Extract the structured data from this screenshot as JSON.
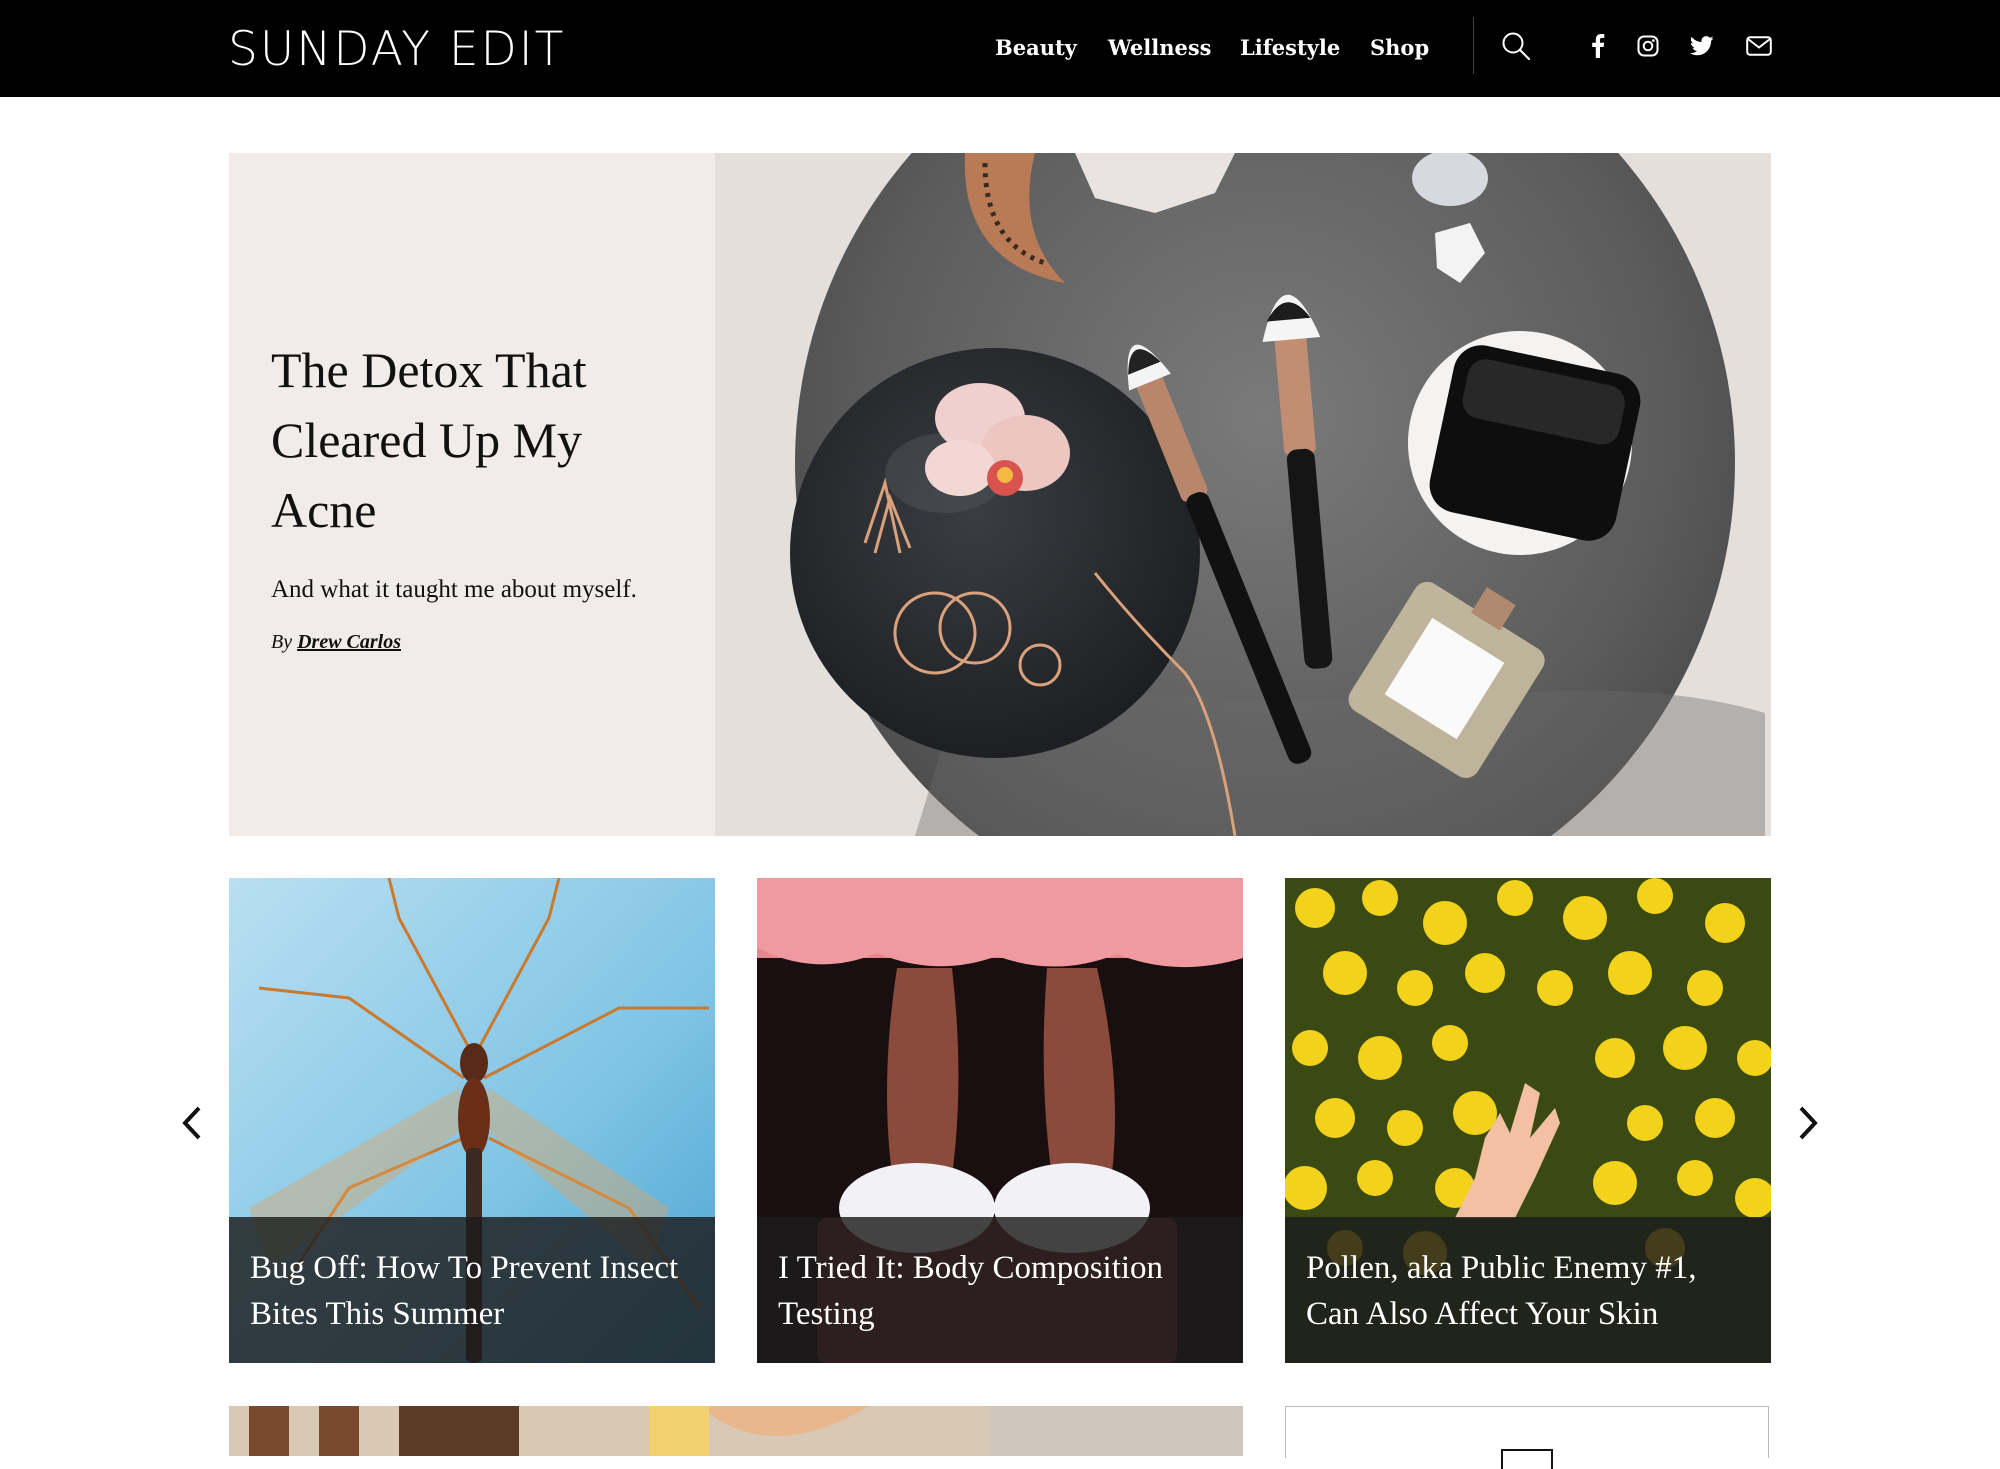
{
  "site": {
    "logo": "SUNDAY EDIT"
  },
  "nav": {
    "items": [
      {
        "label": "Beauty"
      },
      {
        "label": "Wellness"
      },
      {
        "label": "Lifestyle"
      },
      {
        "label": "Shop"
      }
    ]
  },
  "header_icons": [
    "search-icon",
    "facebook-icon",
    "instagram-icon",
    "twitter-icon",
    "email-icon"
  ],
  "hero": {
    "title": "The Detox That Cleared Up My Acne",
    "dek": "And what it taught me about myself.",
    "byline_prefix": "By",
    "author": "Drew Carlos"
  },
  "carousel": {
    "cards": [
      {
        "title": "Bug Off: How To Prevent Insect Bites This Summer"
      },
      {
        "title": "I Tried It: Body Composition Testing"
      },
      {
        "title": "Pollen, aka Public Enemy #1, Can Also Affect Your Skin"
      }
    ],
    "prev_icon": "chevron-left-icon",
    "next_icon": "chevron-right-icon"
  },
  "colors": {
    "header_bg": "#000000",
    "hero_panel_bg": "#f1ebe9",
    "caption_bg": "#1c1c1c"
  }
}
